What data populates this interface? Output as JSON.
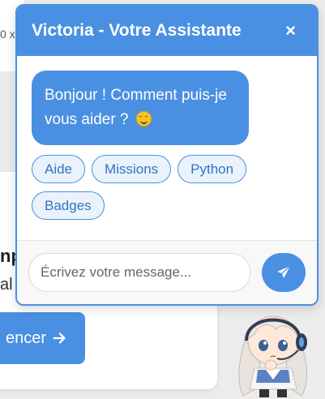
{
  "background": {
    "top_card_text": "0 x",
    "heading_fragment": "np",
    "sub_fragment": "al",
    "start_button_label": "encer"
  },
  "chat": {
    "title": "Victoria - Votre Assistante",
    "close_label": "×",
    "greeting": "Bonjour ! Comment puis-je vous aider ?",
    "quick_replies": [
      "Aide",
      "Missions",
      "Python",
      "Badges"
    ],
    "input_placeholder": "Écrivez votre message..."
  },
  "colors": {
    "accent": "#4a90e2",
    "chip_bg": "#eaf3fc",
    "page_bg": "#ececec"
  },
  "icons": {
    "close": "close-icon",
    "send": "paper-plane-icon",
    "arrow": "arrow-right-icon",
    "emoji": "smiling-face-icon"
  }
}
